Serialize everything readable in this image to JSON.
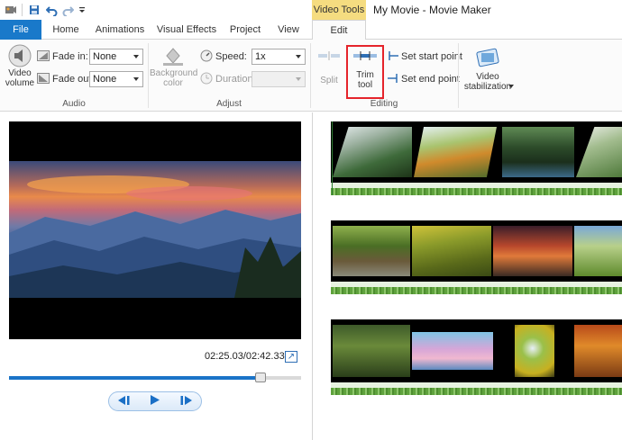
{
  "window": {
    "title": "My Movie - Movie Maker",
    "context_tab": "Video Tools"
  },
  "quick_access": {
    "icons": [
      "app-menu-icon",
      "save-icon",
      "undo-icon",
      "redo-icon",
      "customize-icon"
    ]
  },
  "tabs": [
    {
      "id": "file",
      "label": "File"
    },
    {
      "id": "home",
      "label": "Home"
    },
    {
      "id": "animations",
      "label": "Animations"
    },
    {
      "id": "visual-effects",
      "label": "Visual Effects"
    },
    {
      "id": "project",
      "label": "Project"
    },
    {
      "id": "view",
      "label": "View"
    },
    {
      "id": "edit",
      "label": "Edit"
    }
  ],
  "ribbon": {
    "audio": {
      "group_label": "Audio",
      "video_volume_label": "Video volume",
      "fade_in_label": "Fade in:",
      "fade_in_value": "None",
      "fade_out_label": "Fade out:",
      "fade_out_value": "None"
    },
    "adjust": {
      "group_label": "Adjust",
      "background_color_label": "Background color",
      "speed_label": "Speed:",
      "speed_value": "1x",
      "duration_label": "Duration:",
      "duration_value": ""
    },
    "editing": {
      "group_label": "Editing",
      "split_label": "Split",
      "trim_tool_label": "Trim tool",
      "set_start_point_label": "Set start point",
      "set_end_point_label": "Set end point"
    },
    "stabilization": {
      "video_stabilization_label": "Video stabilization"
    }
  },
  "preview": {
    "time_display": "02:25.03/02:42.33",
    "seek_progress": 0.86
  },
  "colors": {
    "accent": "#1979ca",
    "context_tab": "#f5dc80",
    "highlight": "#e5242b",
    "audio": "#5fa23d"
  }
}
